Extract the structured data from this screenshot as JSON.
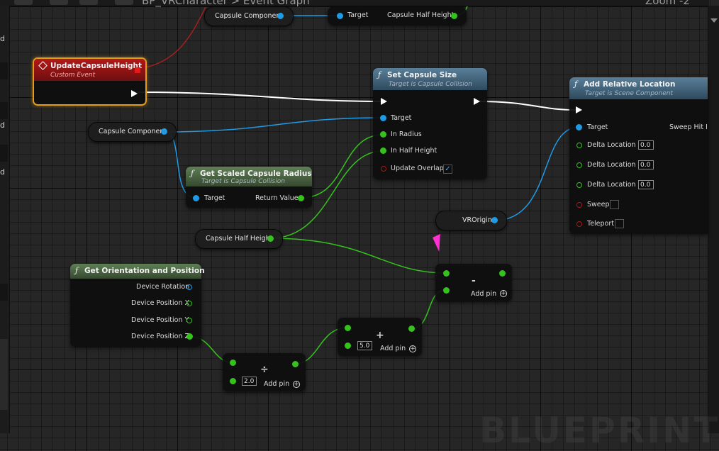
{
  "topbar": {
    "breadcrumb": "BP_VRCharacter > Event Graph",
    "zoom": "Zoom -2"
  },
  "left_strip": {
    "labels": [
      "d",
      "d",
      "d"
    ]
  },
  "colors": {
    "object_pin": "#1f9be6",
    "float_pin": "#35c21d",
    "bool_pin": "#a51818",
    "exec_wire": "#ffffff",
    "event_outline": "#e39b1a",
    "function_header": "#2e4a5e",
    "pure_header": "#35482f"
  },
  "watermark": "BLUEPRINT",
  "nodes": {
    "top_capsule": {
      "label": "Capsule Component"
    },
    "top_get_height": {
      "target": "Target",
      "output": "Capsule Half Height"
    },
    "event": {
      "title": "UpdateCapsuleHeight",
      "subtitle": "Custom Event"
    },
    "set_size": {
      "title": "Set Capsule Size",
      "subtitle": "Target is Capsule Collision",
      "target": "Target",
      "radius": "In Radius",
      "half_height": "In Half Height",
      "update_overlaps": "Update Overlaps",
      "update_overlaps_checked": true
    },
    "add_rel": {
      "title": "Add Relative Location",
      "subtitle": "Target is Scene Component",
      "target": "Target",
      "sweep_hit": "Sweep Hit I",
      "dx": "Delta Location X",
      "dx_val": "0.0",
      "dy": "Delta Location Y",
      "dy_val": "0.0",
      "dz": "Delta Location Z",
      "dz_val": "0.0",
      "sweep": "Sweep",
      "teleport": "Teleport"
    },
    "capsule_var": {
      "label": "Capsule Component"
    },
    "scaled_radius": {
      "title": "Get Scaled Capsule Radius",
      "subtitle": "Target is Capsule Collision",
      "target": "Target",
      "return": "Return Value"
    },
    "half_height_var": {
      "label": "Capsule Half Height"
    },
    "vr_origin": {
      "label": "VROrigin"
    },
    "orient": {
      "title": "Get Orientation and Position",
      "rot": "Device Rotation",
      "px": "Device Position X",
      "py": "Device Position Y",
      "pz": "Device Position Z"
    },
    "divide": {
      "op": "÷",
      "value": "2.0",
      "add_pin": "Add pin"
    },
    "add": {
      "op": "+",
      "value": "5.0",
      "add_pin": "Add pin"
    },
    "subtract": {
      "op": "-",
      "add_pin": "Add pin"
    }
  }
}
